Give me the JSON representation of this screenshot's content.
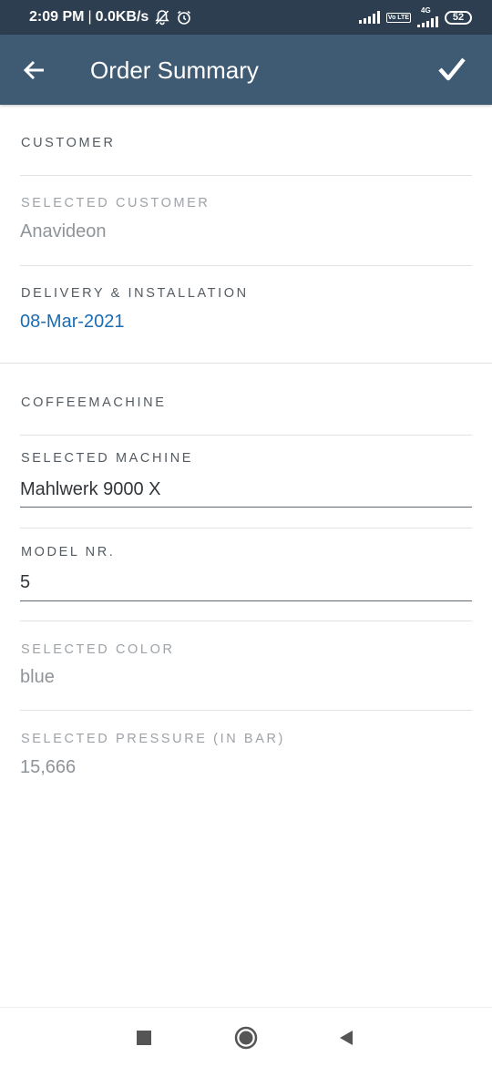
{
  "status_bar": {
    "time": "2:09 PM",
    "speed": "0.0KB/s",
    "battery": "52",
    "network": "4G",
    "volte": "Vo LTE"
  },
  "app_bar": {
    "title": "Order Summary",
    "back_icon": "arrow-left-icon",
    "confirm_icon": "checkmark-icon"
  },
  "customer_section": {
    "header": "CUSTOMER",
    "selected_customer_label": "SELECTED CUSTOMER",
    "selected_customer_value": "Anavideon",
    "delivery_label": "DELIVERY & INSTALLATION",
    "delivery_value": "08-Mar-2021"
  },
  "coffee_section": {
    "header": "COFFEEMACHINE",
    "machine_label": "SELECTED MACHINE",
    "machine_value": "Mahlwerk 9000 X",
    "model_label": "MODEL NR.",
    "model_value": "5",
    "color_label": "SELECTED COLOR",
    "color_value": "blue",
    "pressure_label": "SELECTED PRESSURE (IN BAR)",
    "pressure_value": "15,666"
  },
  "colors": {
    "status_bar": "#2c3e50",
    "app_bar": "#3f5a73",
    "link": "#1b6cb3"
  }
}
